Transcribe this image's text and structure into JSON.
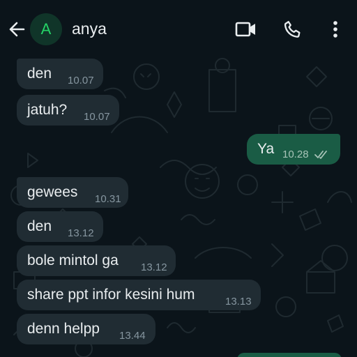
{
  "header": {
    "contact_initial": "A",
    "contact_name": "anya",
    "icons": [
      "arrow-left",
      "video-camera",
      "phone",
      "more-vertical"
    ]
  },
  "messages": [
    {
      "direction": "incoming",
      "text": "den",
      "time": "10.07"
    },
    {
      "direction": "incoming",
      "text": "jatuh?",
      "time": "10.07"
    },
    {
      "direction": "outgoing",
      "text": "Ya",
      "time": "10.28",
      "status": "read"
    },
    {
      "direction": "incoming",
      "text": "gewees",
      "time": "10.31"
    },
    {
      "direction": "incoming",
      "text": "den",
      "time": "13.12"
    },
    {
      "direction": "incoming",
      "text": "bole mintol ga",
      "time": "13.12"
    },
    {
      "direction": "incoming",
      "text": "share ppt infor kesini hum",
      "time": "13.13"
    },
    {
      "direction": "incoming",
      "text": "denn helpp",
      "time": "13.44"
    }
  ],
  "colors": {
    "background": "#0b141a",
    "incoming_bubble": "#202c33",
    "outgoing_bubble": "#1a5c45",
    "accent": "#25d366",
    "read_ticks": "#a8c4b8"
  }
}
